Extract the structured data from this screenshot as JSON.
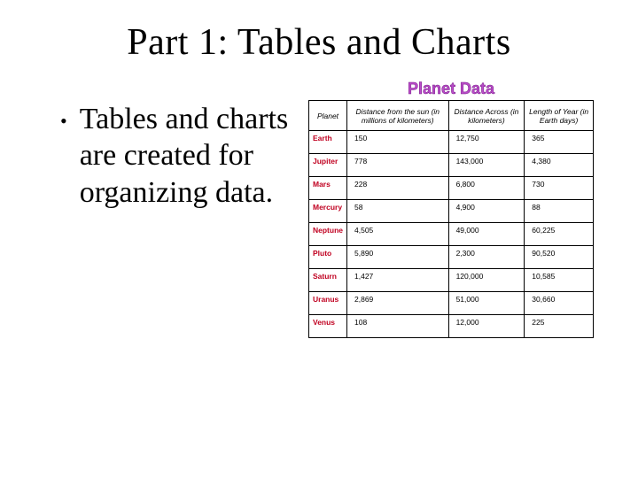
{
  "title": "Part 1:  Tables and Charts",
  "bullet": "Tables and charts are created for organizing data.",
  "table_title": "Planet Data",
  "headers": [
    "Planet",
    "Distance from the sun (in millions of kilometers)",
    "Distance Across (in kilometers)",
    "Length of Year (in Earth days)"
  ],
  "rows": [
    {
      "p": "Earth",
      "d": "150",
      "a": "12,750",
      "y": "365"
    },
    {
      "p": "Jupiter",
      "d": "778",
      "a": "143,000",
      "y": "4,380"
    },
    {
      "p": "Mars",
      "d": "228",
      "a": "6,800",
      "y": "730"
    },
    {
      "p": "Mercury",
      "d": "58",
      "a": "4,900",
      "y": "88"
    },
    {
      "p": "Neptune",
      "d": "4,505",
      "a": "49,000",
      "y": "60,225"
    },
    {
      "p": "Pluto",
      "d": "5,890",
      "a": "2,300",
      "y": "90,520"
    },
    {
      "p": "Saturn",
      "d": "1,427",
      "a": "120,000",
      "y": "10,585"
    },
    {
      "p": "Uranus",
      "d": "2,869",
      "a": "51,000",
      "y": "30,660"
    },
    {
      "p": "Venus",
      "d": "108",
      "a": "12,000",
      "y": "225"
    }
  ]
}
